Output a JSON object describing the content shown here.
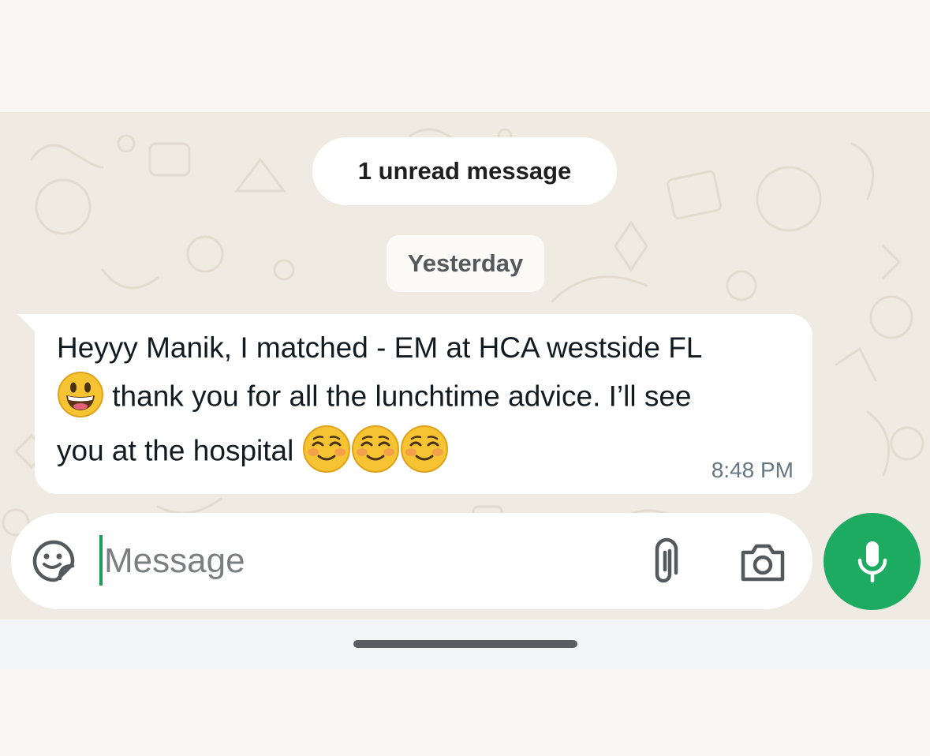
{
  "chat": {
    "unread_banner": "1 unread message",
    "date_separator": "Yesterday",
    "message": {
      "line1": "Heyyy Manik, I matched - EM at HCA westside FL",
      "line2_text": " thank you for all the lunchtime advice. I’ll see",
      "line3_text": "you at the hospital ",
      "emoji_line2": "grinning-face",
      "emoji_line3": [
        "smiling-face",
        "smiling-face",
        "smiling-face"
      ],
      "time": "8:48 PM"
    }
  },
  "composer": {
    "placeholder": "Message",
    "value": "",
    "icons": {
      "sticker": "sticker-icon",
      "attach": "paperclip-icon",
      "camera": "camera-icon",
      "mic": "microphone-icon"
    }
  },
  "colors": {
    "accent": "#1daa61",
    "wallpaper": "#efeae2",
    "bubble": "#ffffff",
    "time_text": "#667781"
  }
}
